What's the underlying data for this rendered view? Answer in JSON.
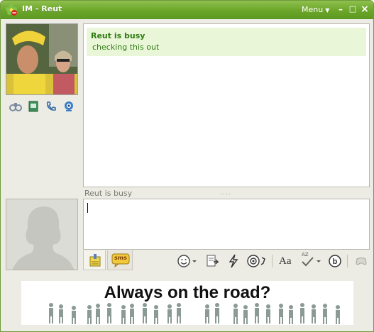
{
  "window": {
    "title": "IM - Reut",
    "menu_label": "Menu",
    "minimize_label": "–",
    "maximize_label": "□",
    "close_label": "×"
  },
  "contact": {
    "photo": "contact-photo",
    "actions": [
      "binoculars-icon",
      "notebook-icon",
      "phone-icon",
      "webcam-icon"
    ]
  },
  "chat": {
    "status_title": "Reut is busy",
    "status_message": "checking this out"
  },
  "compose": {
    "typing_label": "Reut is busy",
    "splitter": "....",
    "input_value": ""
  },
  "toolbar": {
    "left_tabs": [
      "notepad-icon",
      "sms-icon"
    ],
    "sms_label": "sms",
    "buttons": [
      "smiley-icon",
      "file-transfer-icon",
      "nudge-icon",
      "voice-clip-icon",
      "font-icon",
      "spell-check-icon",
      "b-icon",
      "games-icon"
    ],
    "font_label": "Aa",
    "spell_label": "AZ"
  },
  "ad": {
    "text": "Always on the road?"
  },
  "colors": {
    "titlebar": "#6ba52a",
    "status_bg": "#e9f6d8",
    "status_text": "#2f7a12",
    "window_bg": "#ecebe4"
  }
}
